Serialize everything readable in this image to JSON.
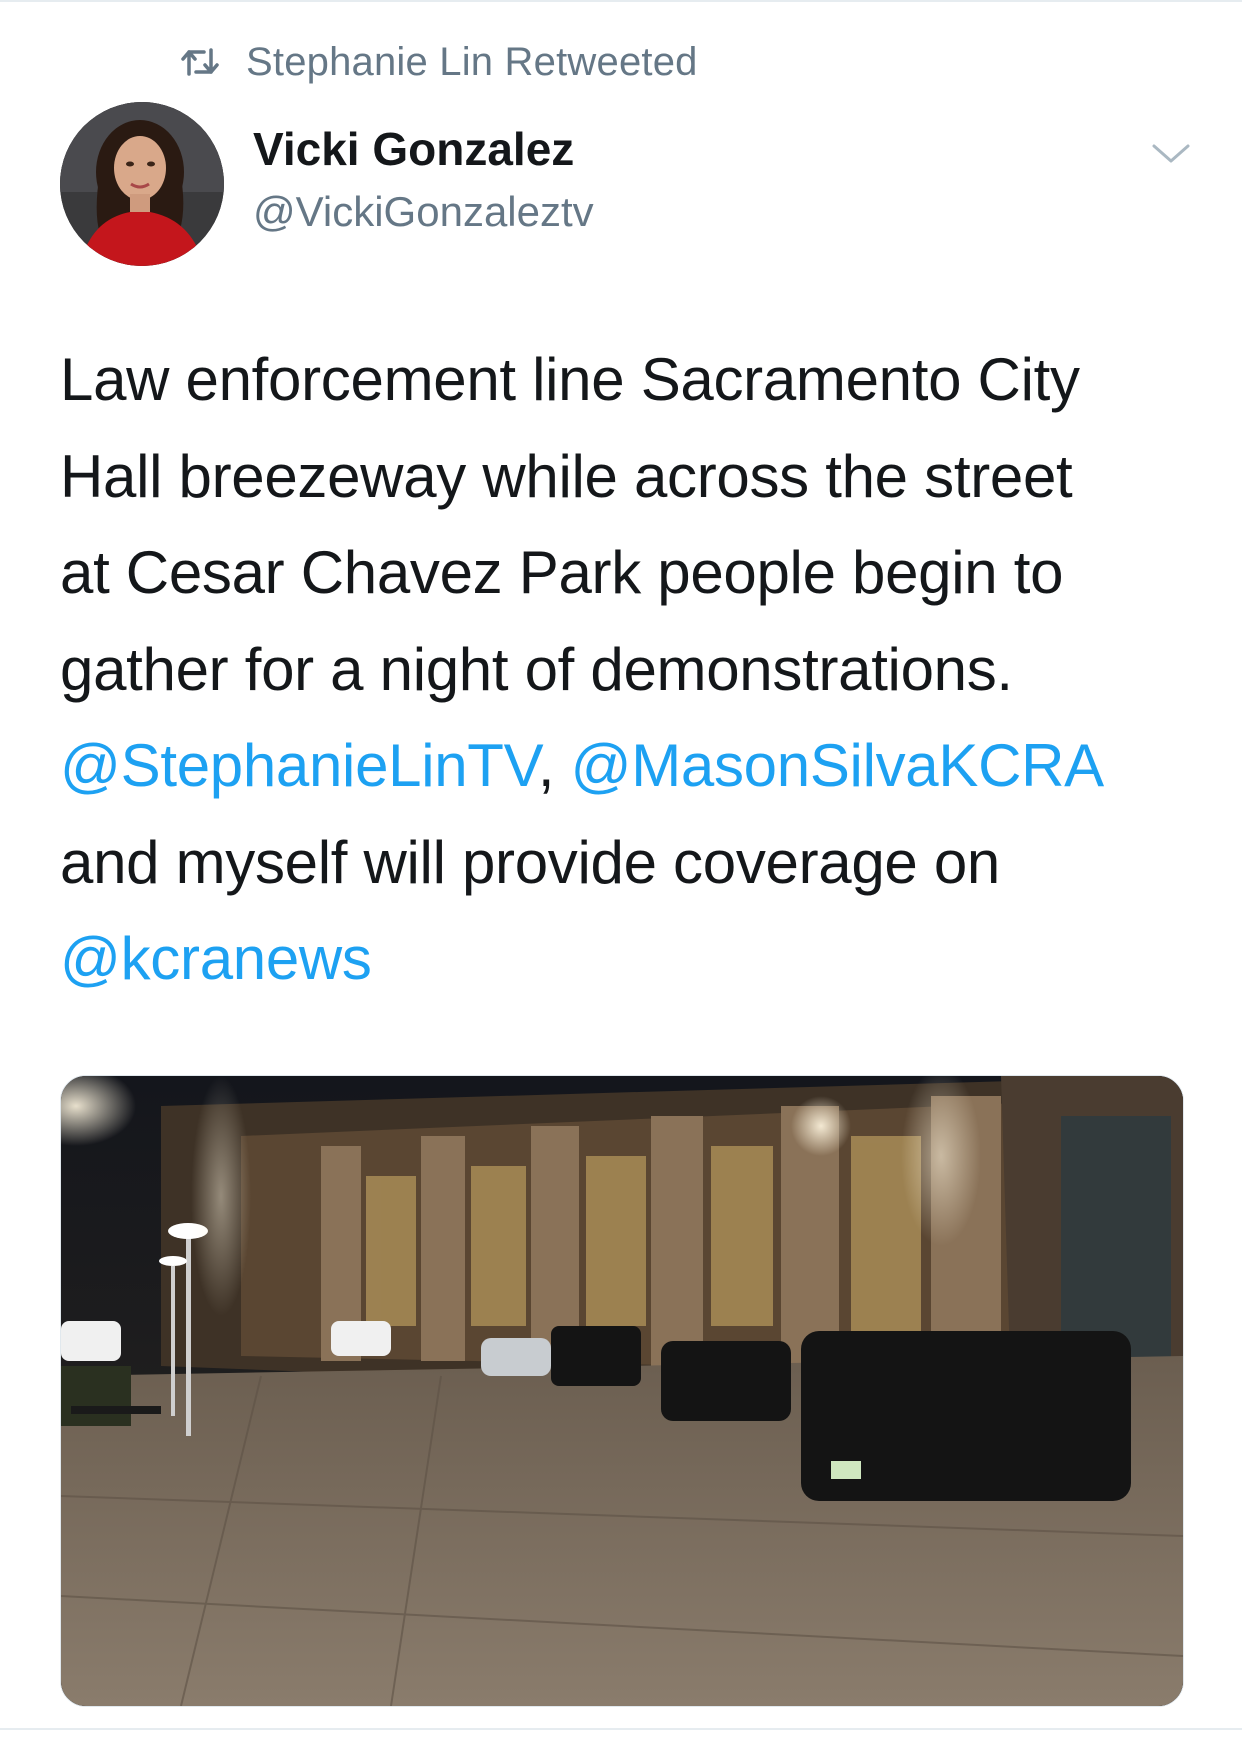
{
  "retweet": {
    "icon": "retweet-icon",
    "label": "Stephanie Lin Retweeted"
  },
  "author": {
    "display_name": "Vicki Gonzalez",
    "handle": "@VickiGonzaleztv",
    "avatar_icon": "avatar"
  },
  "menu": {
    "icon": "chevron-down-icon"
  },
  "tweet": {
    "line1": "Law enforcement line Sacramento City",
    "line2": "Hall breezeway while across the street",
    "line3": "at Cesar Chavez Park people begin to",
    "line4": "gather for a night of demonstrations.",
    "mention1": "@StephanieLinTV",
    "sep": ",",
    "mention2": "@MasonSilvaKCRA",
    "line6": "and myself will provide coverage on",
    "mention3": "@kcranews"
  },
  "colors": {
    "link": "#1da1f2",
    "secondary": "#657786",
    "text": "#14171a"
  }
}
